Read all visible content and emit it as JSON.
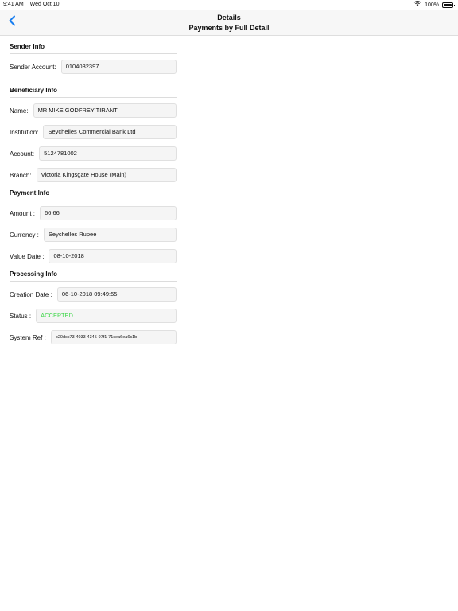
{
  "status_bar": {
    "time": "9:41 AM",
    "date": "Wed Oct 10",
    "battery": "100%"
  },
  "nav": {
    "title": "Details",
    "subtitle": "Payments by Full Detail"
  },
  "sender": {
    "section_title": "Sender Info",
    "account_label": "Sender Account:",
    "account_value": "0104032397"
  },
  "beneficiary": {
    "section_title": "Beneficiary Info",
    "name_label": "Name:",
    "name_value": "MR MIKE GODFREY TIRANT",
    "institution_label": "Institution:",
    "institution_value": "Seychelles Commercial Bank Ltd",
    "account_label": "Account:",
    "account_value": "5124781002",
    "branch_label": "Branch:",
    "branch_value": "Victoria Kingsgate House (Main)"
  },
  "payment": {
    "section_title": "Payment Info",
    "amount_label": "Amount :",
    "amount_value": "66.66",
    "currency_label": "Currency :",
    "currency_value": "Seychelles Rupee",
    "value_date_label": "Value Date :",
    "value_date_value": "08-10-2018"
  },
  "processing": {
    "section_title": "Processing Info",
    "creation_date_label": "Creation Date :",
    "creation_date_value": "06-10-2018 09:49:55",
    "status_label": "Status :",
    "status_value": "ACCEPTED",
    "status_color": "#3fd74a",
    "system_ref_label": "System Ref :",
    "system_ref_value": "b20dcc73-4033-4345-97f1-71cea6ea6c1b"
  },
  "colors": {
    "accent": "#1a7ff0"
  }
}
